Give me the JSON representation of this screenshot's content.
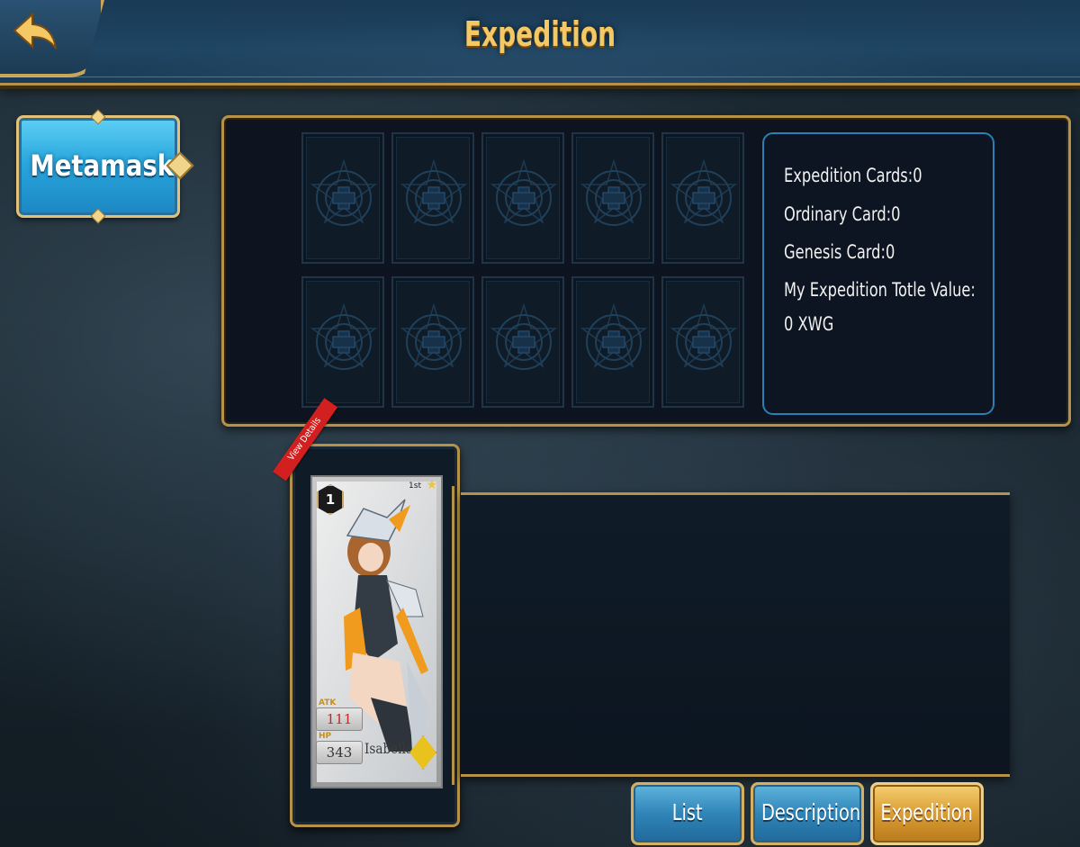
{
  "header": {
    "title": "Expedition"
  },
  "sidebar": {
    "wallet_label": "Metamask"
  },
  "expedition_slots": {
    "rows": [
      [
        "empty-slot",
        "empty-slot",
        "empty-slot",
        "empty-slot",
        "empty-slot"
      ],
      [
        "empty-slot",
        "empty-slot",
        "empty-slot",
        "empty-slot",
        "empty-slot"
      ]
    ]
  },
  "summary": {
    "expedition_cards": "Expedition Cards:0",
    "ordinary_card": "Ordinary Card:0",
    "genesis_card": "Genesis Card:0",
    "total_value_label": "My Expedition Totle Value:",
    "total_value": "0 XWG"
  },
  "card": {
    "ribbon": "View Details",
    "level": "1",
    "rank": "1st",
    "atk_label": "ATK",
    "atk": "111",
    "hp_label": "HP",
    "hp": "343",
    "name": "Isabella"
  },
  "tabs": {
    "list": "List",
    "description": "Description",
    "expedition": "Expedition"
  },
  "colors": {
    "gold_accent": "#b69248",
    "title_gold": "#f3c865",
    "button_blue": "#2f84b8",
    "button_gold": "#d99d33"
  }
}
